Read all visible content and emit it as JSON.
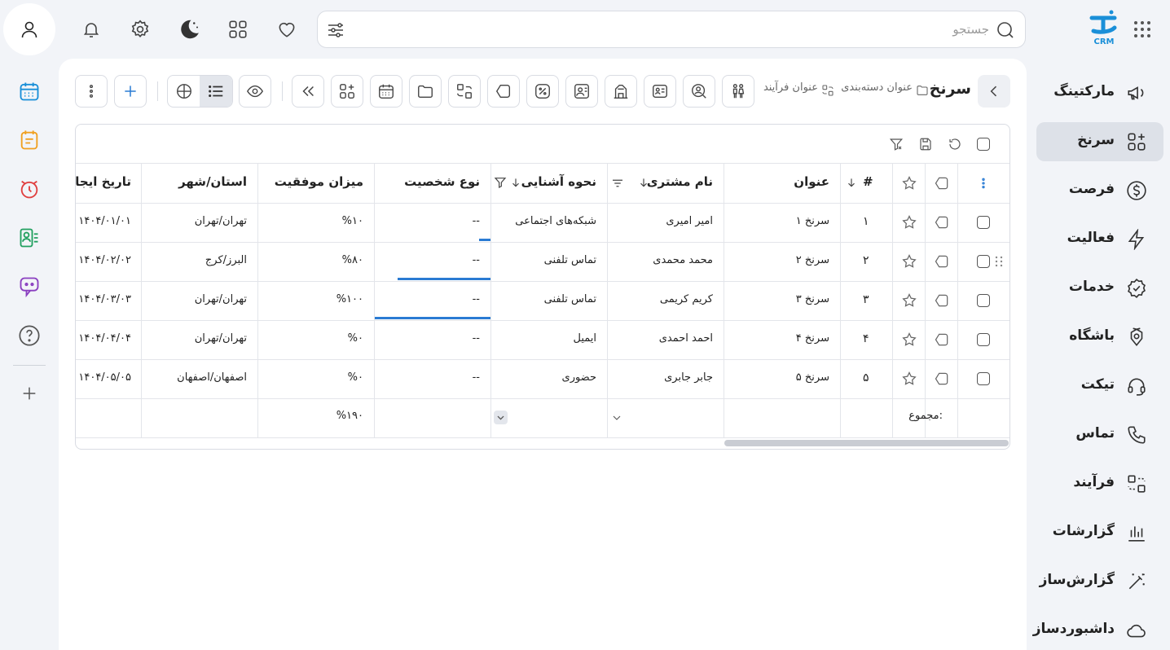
{
  "header": {
    "search_placeholder": "جستجو",
    "logo_text": "CRM"
  },
  "sidebar": {
    "items": [
      {
        "label": "مارکتینگ",
        "icon": "megaphone-icon"
      },
      {
        "label": "سرنخ",
        "icon": "leads-icon",
        "active": true
      },
      {
        "label": "فرصت",
        "icon": "dollar-icon"
      },
      {
        "label": "فعالیت",
        "icon": "bolt-icon"
      },
      {
        "label": "خدمات",
        "icon": "badge-check-icon"
      },
      {
        "label": "باشگاه",
        "icon": "club-icon"
      },
      {
        "label": "تیکت",
        "icon": "headset-icon"
      },
      {
        "label": "تماس",
        "icon": "phone-icon"
      },
      {
        "label": "فرآیند",
        "icon": "process-icon"
      },
      {
        "label": "گزارشات",
        "icon": "bar-chart-icon"
      },
      {
        "label": "گزارش‌ساز",
        "icon": "magic-wand-icon"
      },
      {
        "label": "داشبوردساز",
        "icon": "cloud-icon"
      }
    ]
  },
  "page": {
    "title": "سرنخ",
    "crumb_category": "عنوان دسته‌بندی",
    "crumb_process": "عنوان فرآیند"
  },
  "table": {
    "columns": [
      "#",
      "عنوان",
      "نام مشتری",
      "نحوه آشنایی",
      "نوع شخصیت",
      "میزان موفقیت",
      "استان/شهر",
      "تاریخ ایجاد"
    ],
    "rows": [
      {
        "num": "۱",
        "title": "سرنخ ۱",
        "customer": "امیر امیری",
        "source": "شبکه‌های اجتماعی",
        "type": "--",
        "success": "%۱۰",
        "success_value": 10,
        "city": "تهران/تهران",
        "date": "۱۴۰۴/۰۱/۰۱"
      },
      {
        "num": "۲",
        "title": "سرنخ ۲",
        "customer": "محمد محمدی",
        "source": "تماس تلفنی",
        "type": "--",
        "success": "%۸۰",
        "success_value": 80,
        "city": "البرز/کرج",
        "date": "۱۴۰۴/۰۲/۰۲"
      },
      {
        "num": "۳",
        "title": "سرنخ ۳",
        "customer": "کریم کریمی",
        "source": "تماس تلفنی",
        "type": "--",
        "success": "%۱۰۰",
        "success_value": 100,
        "city": "تهران/تهران",
        "date": "۱۴۰۴/۰۳/۰۳"
      },
      {
        "num": "۴",
        "title": "سرنخ ۴",
        "customer": "احمد احمدی",
        "source": "ایمیل",
        "type": "--",
        "success": "%۰",
        "success_value": 0,
        "city": "تهران/تهران",
        "date": "۱۴۰۴/۰۴/۰۴"
      },
      {
        "num": "۵",
        "title": "سرنخ ۵",
        "customer": "جابر جابری",
        "source": "حضوری",
        "type": "--",
        "success": "%۰",
        "success_value": 0,
        "city": "اصفهان/اصفهان",
        "date": "۱۴۰۴/۰۵/۰۵"
      }
    ],
    "footer": {
      "label": "مجموع:",
      "success_total": "%۱۹۰"
    }
  },
  "colors": {
    "accent": "#2a7bd3",
    "brand": "#1a8fd8"
  }
}
